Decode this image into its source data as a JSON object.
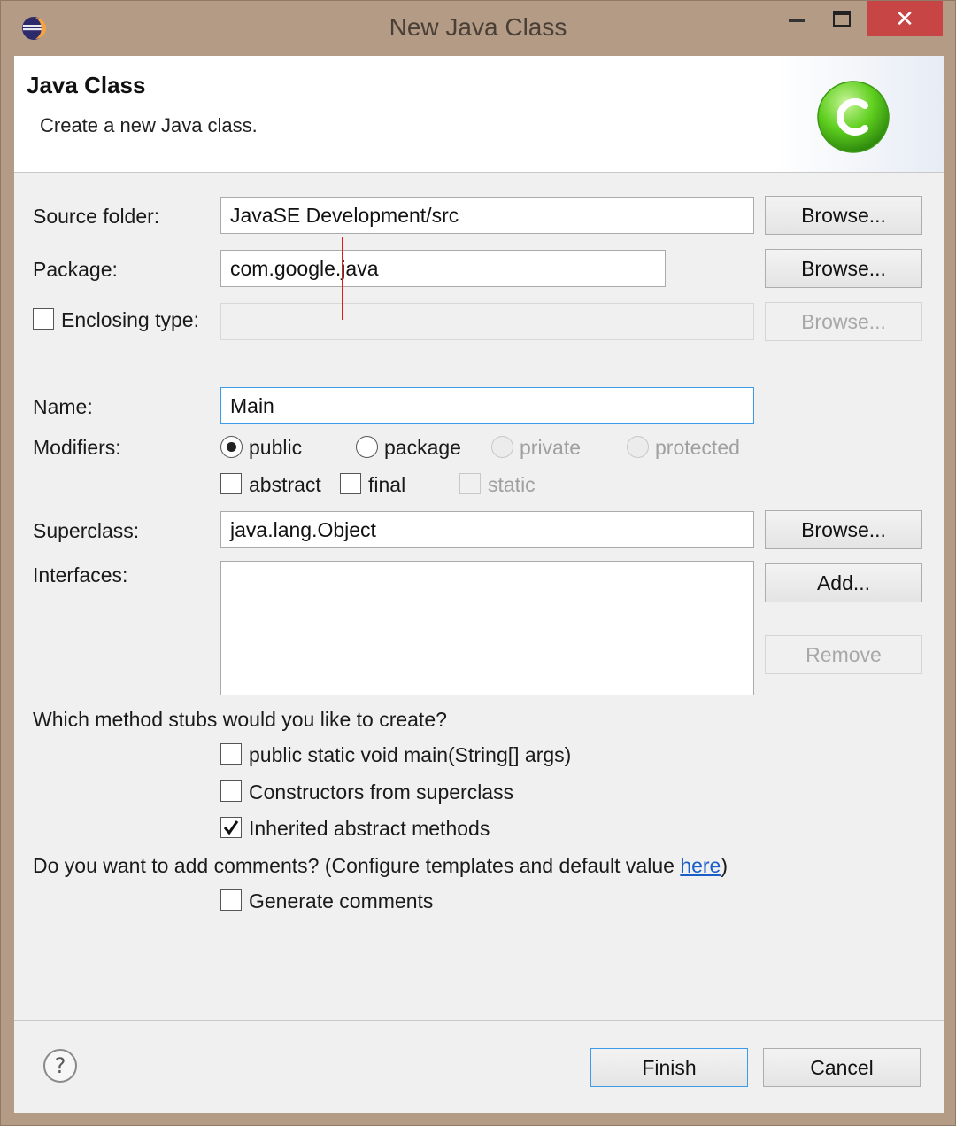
{
  "window": {
    "title": "New Java Class",
    "close_glyph": "✕"
  },
  "header": {
    "title": "Java Class",
    "description": "Create a new Java class.",
    "icon": "class-c-icon",
    "icon_letter": "C"
  },
  "source_folder": {
    "label": "Source folder:",
    "value": "JavaSE Development/src",
    "browse_label": "Browse..."
  },
  "package": {
    "label": "Package:",
    "value": "com.google.java",
    "browse_label": "Browse..."
  },
  "enclosing_type": {
    "label": "Enclosing type:",
    "checked": false,
    "value": "",
    "browse_label": "Browse..."
  },
  "name": {
    "label": "Name:",
    "value": "Main"
  },
  "modifiers": {
    "label": "Modifiers:",
    "access": [
      {
        "label": "public",
        "checked": true,
        "enabled": true
      },
      {
        "label": "package",
        "checked": false,
        "enabled": true
      },
      {
        "label": "private",
        "checked": false,
        "enabled": false
      },
      {
        "label": "protected",
        "checked": false,
        "enabled": false
      }
    ],
    "flags": [
      {
        "label": "abstract",
        "checked": false,
        "enabled": true
      },
      {
        "label": "final",
        "checked": false,
        "enabled": true
      },
      {
        "label": "static",
        "checked": false,
        "enabled": false
      }
    ]
  },
  "superclass": {
    "label": "Superclass:",
    "value": "java.lang.Object",
    "browse_label": "Browse..."
  },
  "interfaces": {
    "label": "Interfaces:",
    "items": [],
    "add_label": "Add...",
    "remove_label": "Remove"
  },
  "method_stubs": {
    "question": "Which method stubs would you like to create?",
    "options": [
      {
        "label": "public static void main(String[] args)",
        "checked": false
      },
      {
        "label": "Constructors from superclass",
        "checked": false
      },
      {
        "label": "Inherited abstract methods",
        "checked": true
      }
    ]
  },
  "comments": {
    "question_prefix": "Do you want to add comments? (Configure templates and default value ",
    "link_text": "here",
    "question_suffix": ")",
    "option_label": "Generate comments",
    "option_checked": false
  },
  "footer": {
    "help_glyph": "?",
    "finish_label": "Finish",
    "cancel_label": "Cancel"
  },
  "colors": {
    "frame": "#b39b86",
    "close_button": "#c74545",
    "focus_border": "#3c9be8",
    "link": "#1a5fc8",
    "icon_green": "#5fcf1f"
  }
}
